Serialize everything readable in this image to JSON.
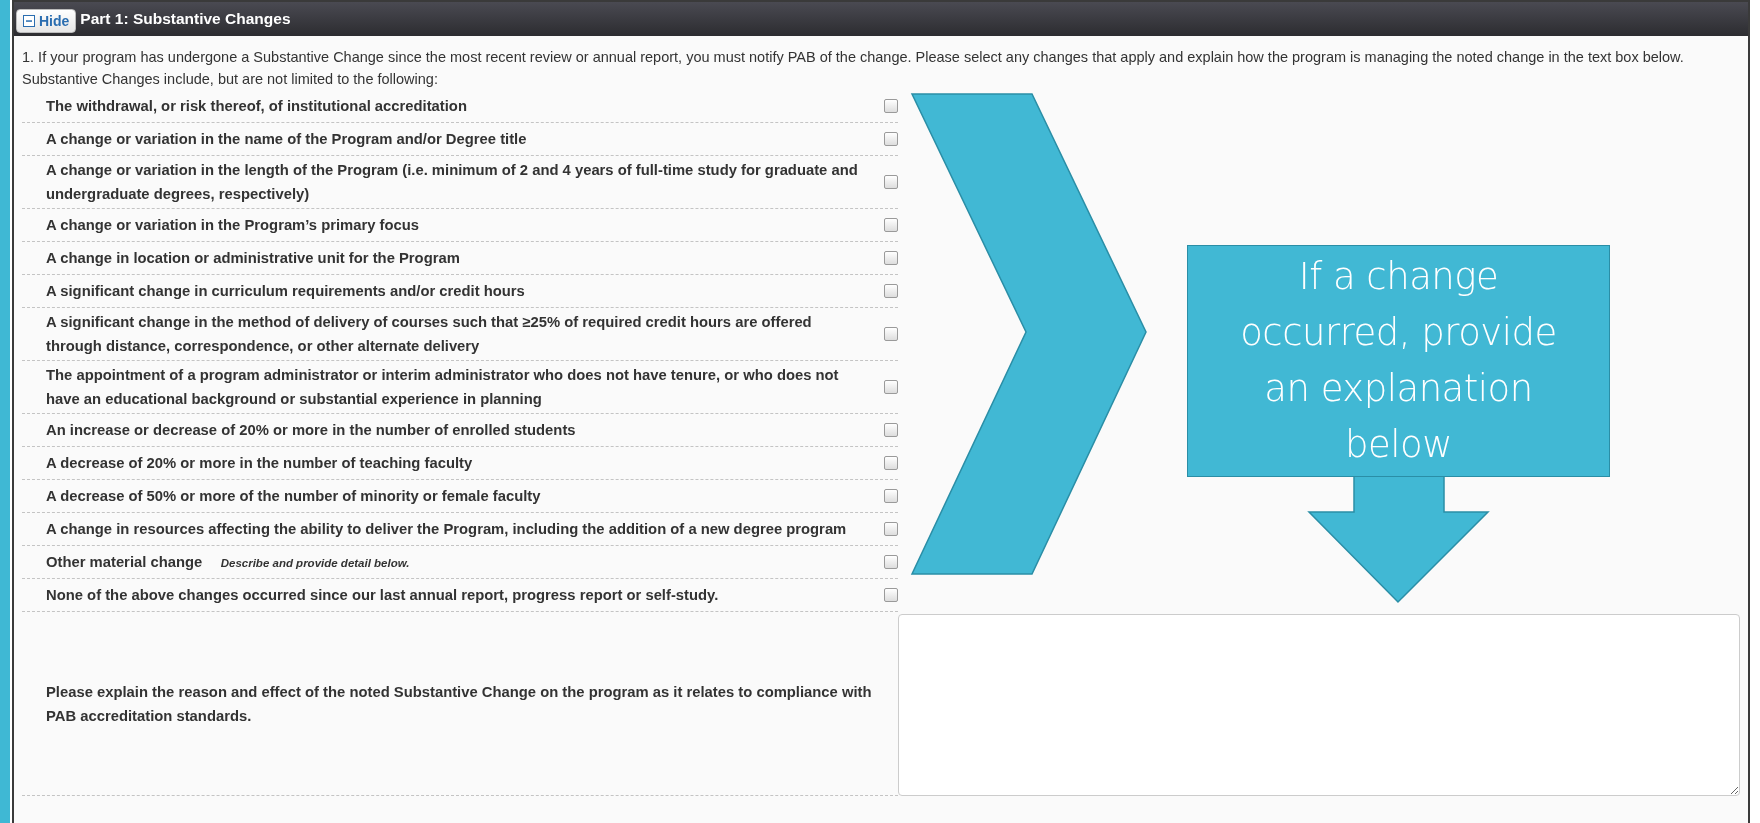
{
  "panel": {
    "toggle": {
      "label": "Hide"
    },
    "title": "Part 1: Substantive Changes"
  },
  "intro": "1. If your program has undergone a Substantive Change since the most recent review or annual report, you must notify PAB of the change. Please select any changes that apply and explain how the program is managing the noted change in the text box below. Substantive Changes include, but are not limited to the following:",
  "changes": [
    {
      "label": "The withdrawal, or risk thereof, of institutional accreditation",
      "checked": false
    },
    {
      "label": "A change or variation in the name of the Program and/or Degree title",
      "checked": false
    },
    {
      "label": "A change or variation in the length of the Program (i.e. minimum of 2 and 4 years of full-time study for graduate and undergraduate degrees, respectively)",
      "checked": false
    },
    {
      "label": "A change or variation in the Program’s primary focus",
      "checked": false
    },
    {
      "label": "A change in location or administrative unit for the Program",
      "checked": false
    },
    {
      "label": "A significant change in curriculum requirements and/or credit hours",
      "checked": false
    },
    {
      "label": "A significant change in the method of delivery of courses such that ≥25% of required credit hours are offered through distance, correspondence, or other alternate delivery",
      "checked": false
    },
    {
      "label": "The appointment of a program administrator or interim administrator who does not have tenure, or who does not have an educational background or substantial experience in planning",
      "checked": false
    },
    {
      "label": "An increase or decrease of 20% or more in the number of enrolled students",
      "checked": false
    },
    {
      "label": "A decrease of 20% or more in the number of teaching faculty",
      "checked": false
    },
    {
      "label": "A decrease of 50% or more of the number of minority or female faculty",
      "checked": false
    },
    {
      "label": "A change in resources affecting the ability to deliver the Program, including the addition of a new degree program",
      "checked": false
    },
    {
      "label": "Other material change",
      "hint": "Describe and provide detail below.",
      "checked": false
    },
    {
      "label": "None of the above changes occurred since our last annual report, progress report or self-study.",
      "checked": false
    }
  ],
  "callout": "If a change occurred, provide an explanation below",
  "explanation": {
    "label": "Please explain the reason and effect of the noted Substantive Change on the program as it relates to compliance with PAB accreditation standards."
  }
}
